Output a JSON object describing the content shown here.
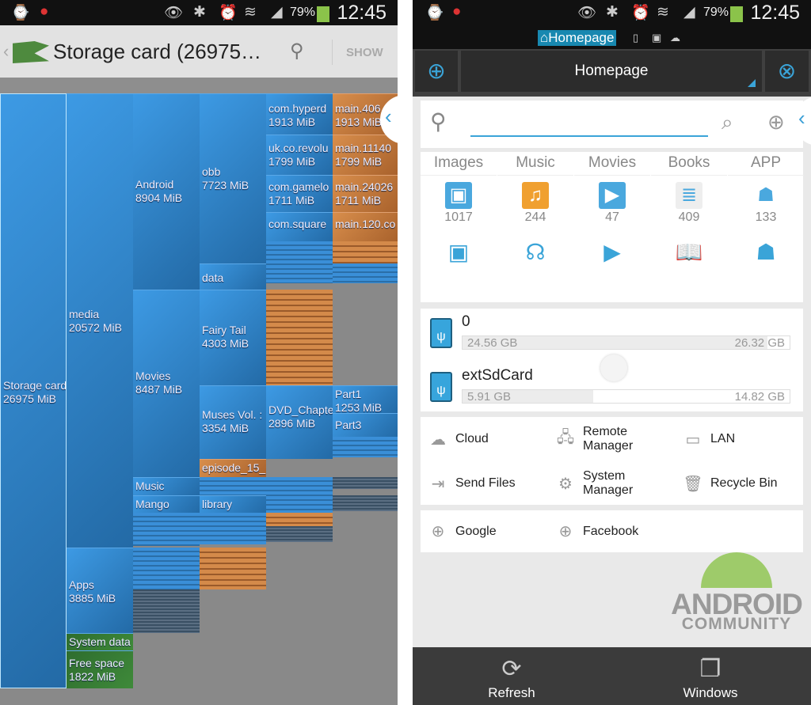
{
  "status": {
    "time": "12:45",
    "battery": "79%"
  },
  "left": {
    "title": "Storage card (26975…",
    "show_label": "SHOW",
    "treemap": {
      "storage": {
        "name": "Storage card",
        "size": "26975 MiB"
      },
      "media": {
        "name": "media",
        "size": "20572 MiB"
      },
      "apps": {
        "name": "Apps",
        "size": "3885 MiB"
      },
      "system": {
        "name": "System data"
      },
      "free": {
        "name": "Free space",
        "size": "1822 MiB"
      },
      "android": {
        "name": "Android",
        "size": "8904 MiB"
      },
      "movies": {
        "name": "Movies",
        "size": "8487 MiB"
      },
      "music": {
        "name": "Music"
      },
      "mango": {
        "name": "Mango"
      },
      "obb": {
        "name": "obb",
        "size": "7723 MiB"
      },
      "data": {
        "name": "data"
      },
      "fairy": {
        "name": "Fairy Tail",
        "size": "4303 MiB"
      },
      "muses": {
        "name": "Muses Vol. :",
        "size": "3354 MiB"
      },
      "episode": {
        "name": "episode_15_"
      },
      "library": {
        "name": "library"
      },
      "hyperd": {
        "name": "com.hyperd",
        "size": "1913 MiB"
      },
      "revolu": {
        "name": "uk.co.revolu",
        "size": "1799 MiB"
      },
      "gamelo": {
        "name": "com.gamelo",
        "size": "1711 MiB"
      },
      "square": {
        "name": "com.square"
      },
      "dvd": {
        "name": "DVD_Chapte",
        "size": "2896 MiB"
      },
      "main406": {
        "name": "main.406",
        "size": "1913 MiB"
      },
      "main11140": {
        "name": "main.11140",
        "size": "1799 MiB"
      },
      "main24026": {
        "name": "main.24026",
        "size": "1711 MiB"
      },
      "main120": {
        "name": "main.120.co"
      },
      "part1": {
        "name": "Part1",
        "size": "1253 MiB"
      },
      "part3": {
        "name": "Part3"
      }
    }
  },
  "right": {
    "notif_label": "⌂Homepage",
    "window_title": "Homepage",
    "search": {
      "value": "",
      "placeholder": ""
    },
    "categories": [
      {
        "label": "Images",
        "count": "1017",
        "icon": "image-icon"
      },
      {
        "label": "Music",
        "count": "244",
        "icon": "music-icon"
      },
      {
        "label": "Movies",
        "count": "47",
        "icon": "video-icon"
      },
      {
        "label": "Books",
        "count": "409",
        "icon": "book-icon"
      },
      {
        "label": "APP",
        "count": "133",
        "icon": "android-icon"
      }
    ],
    "volumes": [
      {
        "name": "0",
        "used": "24.56 GB",
        "total": "26.32 GB",
        "used_fraction": 0.933
      },
      {
        "name": "extSdCard",
        "used": "5.91 GB",
        "total": "14.82 GB",
        "used_fraction": 0.399
      }
    ],
    "tools": [
      "Cloud",
      "Remote Manager",
      "LAN",
      "Send Files",
      "System Manager",
      "Recycle Bin"
    ],
    "web": [
      "Google",
      "Facebook"
    ],
    "watermark": {
      "line1": "ANDROID",
      "line2": "COMMUNITY"
    },
    "bottom": {
      "refresh": "Refresh",
      "windows": "Windows"
    },
    "colors": {
      "accent": "#3aa4d8",
      "treemap_blue": "#3d9ae4",
      "treemap_orange": "#d88e4c",
      "free_green": "#3f8a3a"
    }
  }
}
